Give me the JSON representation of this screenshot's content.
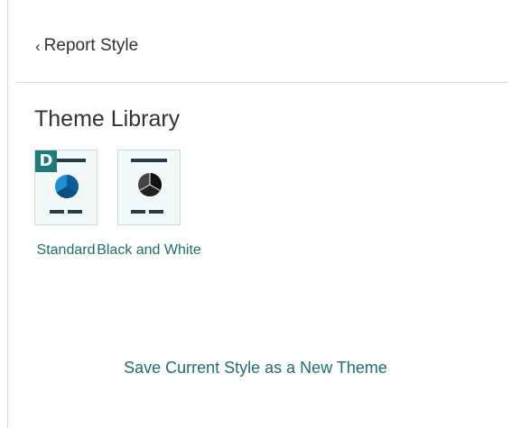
{
  "header": {
    "back_chevron": "‹",
    "back_label": "Report Style"
  },
  "section": {
    "title": "Theme Library"
  },
  "themes": [
    {
      "label": "Standard",
      "is_default": true,
      "default_badge": "D",
      "pie_colors": [
        "#0b5f96",
        "#1d8fd0",
        "#0a4f80"
      ]
    },
    {
      "label": "Black and White",
      "is_default": false,
      "pie_colors": [
        "#111111",
        "#444444",
        "#777777"
      ]
    }
  ],
  "actions": {
    "save_new_theme": "Save Current Style as a New Theme"
  },
  "colors": {
    "accent": "#1f6f6c",
    "badge": "#1f7a7a",
    "text": "#333333",
    "divider": "#d9d9d9"
  }
}
